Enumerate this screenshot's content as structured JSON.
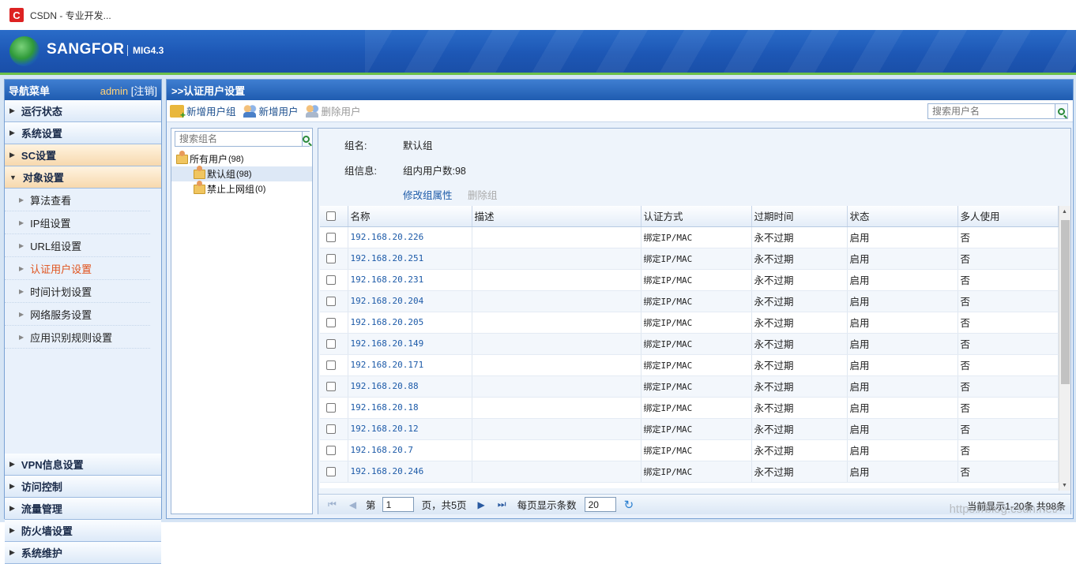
{
  "browser": {
    "favicon": "C",
    "title": "CSDN - 专业开发..."
  },
  "header": {
    "brand": "SANGFOR",
    "product": "MIG4.3"
  },
  "sidebar": {
    "title": "导航菜单",
    "user": "admin",
    "logout": "[注销]",
    "items": [
      {
        "label": "运行状态"
      },
      {
        "label": "系统设置"
      },
      {
        "label": "SC设置"
      },
      {
        "label": "对象设置"
      }
    ],
    "sub_items": [
      {
        "label": "算法查看"
      },
      {
        "label": "IP组设置"
      },
      {
        "label": "URL组设置"
      },
      {
        "label": "认证用户设置"
      },
      {
        "label": "时间计划设置"
      },
      {
        "label": "网络服务设置"
      },
      {
        "label": "应用识别规则设置"
      }
    ],
    "bottom_items": [
      {
        "label": "VPN信息设置"
      },
      {
        "label": "访问控制"
      },
      {
        "label": "流量管理"
      },
      {
        "label": "防火墙设置"
      },
      {
        "label": "系统维护"
      }
    ]
  },
  "main": {
    "title": ">>认证用户设置",
    "toolbar": {
      "add_group": "新增用户组",
      "add_user": "新增用户",
      "delete_user": "删除用户",
      "search_placeholder": "搜索用户名"
    },
    "tree": {
      "search_placeholder": "搜索组名",
      "root": {
        "label": "所有用户",
        "count": "(98)"
      },
      "children": [
        {
          "label": "默认组",
          "count": "(98)"
        },
        {
          "label": "禁止上网组",
          "count": "(0)"
        }
      ]
    },
    "group": {
      "name_label": "组名:",
      "name": "默认组",
      "info_label": "组信息:",
      "info": "组内用户数:98",
      "edit_link": "修改组属性",
      "delete_link": "删除组"
    },
    "table": {
      "headers": [
        "名称",
        "描述",
        "认证方式",
        "过期时间",
        "状态",
        "多人使用"
      ],
      "rows": [
        {
          "name": "192.168.20.226",
          "desc": "",
          "auth": "绑定IP/MAC",
          "expire": "永不过期",
          "status": "启用",
          "multi": "否"
        },
        {
          "name": "192.168.20.251",
          "desc": "",
          "auth": "绑定IP/MAC",
          "expire": "永不过期",
          "status": "启用",
          "multi": "否"
        },
        {
          "name": "192.168.20.231",
          "desc": "",
          "auth": "绑定IP/MAC",
          "expire": "永不过期",
          "status": "启用",
          "multi": "否"
        },
        {
          "name": "192.168.20.204",
          "desc": "",
          "auth": "绑定IP/MAC",
          "expire": "永不过期",
          "status": "启用",
          "multi": "否"
        },
        {
          "name": "192.168.20.205",
          "desc": "",
          "auth": "绑定IP/MAC",
          "expire": "永不过期",
          "status": "启用",
          "multi": "否"
        },
        {
          "name": "192.168.20.149",
          "desc": "",
          "auth": "绑定IP/MAC",
          "expire": "永不过期",
          "status": "启用",
          "multi": "否"
        },
        {
          "name": "192.168.20.171",
          "desc": "",
          "auth": "绑定IP/MAC",
          "expire": "永不过期",
          "status": "启用",
          "multi": "否"
        },
        {
          "name": "192.168.20.88",
          "desc": "",
          "auth": "绑定IP/MAC",
          "expire": "永不过期",
          "status": "启用",
          "multi": "否"
        },
        {
          "name": "192.168.20.18",
          "desc": "",
          "auth": "绑定IP/MAC",
          "expire": "永不过期",
          "status": "启用",
          "multi": "否"
        },
        {
          "name": "192.168.20.12",
          "desc": "",
          "auth": "绑定IP/MAC",
          "expire": "永不过期",
          "status": "启用",
          "multi": "否"
        },
        {
          "name": "192.168.20.7",
          "desc": "",
          "auth": "绑定IP/MAC",
          "expire": "永不过期",
          "status": "启用",
          "multi": "否"
        },
        {
          "name": "192.168.20.246",
          "desc": "",
          "auth": "绑定IP/MAC",
          "expire": "永不过期",
          "status": "启用",
          "multi": "否"
        }
      ]
    },
    "pager": {
      "page_label": "第",
      "page": "1",
      "of_label": "页，共5页",
      "per_page_label": "每页显示条数",
      "per_page": "20",
      "info": "当前显示1-20条 共98条"
    }
  },
  "watermark": "https://blog.csdn.net/",
  "colors": {
    "accent": "#1f5cb0",
    "active_menu": "#e0521c",
    "link": "#1c5aa8"
  }
}
